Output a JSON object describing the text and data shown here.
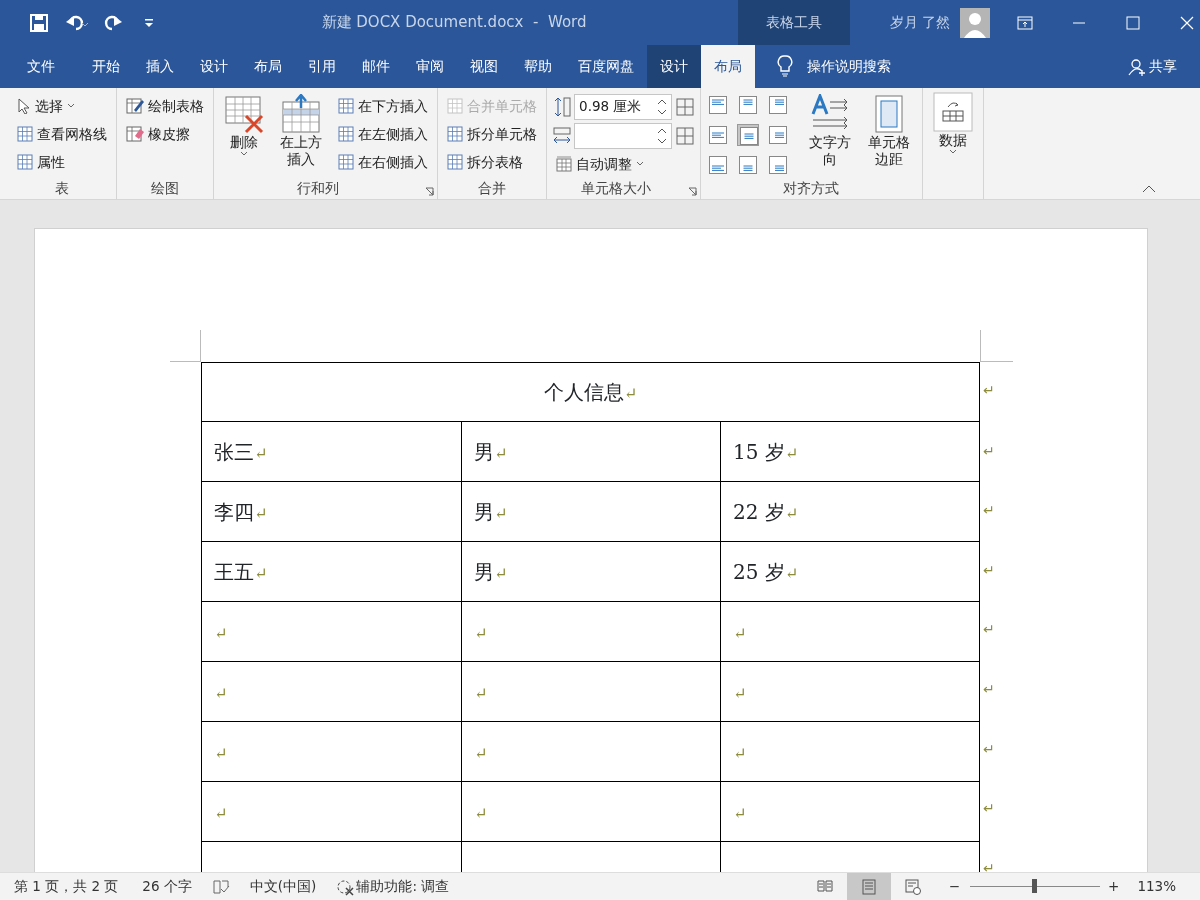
{
  "window": {
    "title": "新建 DOCX Document.docx  -  Word",
    "context_label": "表格工具",
    "user": "岁月 了然"
  },
  "tabs": [
    {
      "label": "文件",
      "selected": false,
      "contextual": false
    },
    {
      "label": "开始",
      "selected": false,
      "contextual": false
    },
    {
      "label": "插入",
      "selected": false,
      "contextual": false
    },
    {
      "label": "设计",
      "selected": false,
      "contextual": false
    },
    {
      "label": "布局",
      "selected": false,
      "contextual": false
    },
    {
      "label": "引用",
      "selected": false,
      "contextual": false
    },
    {
      "label": "邮件",
      "selected": false,
      "contextual": false
    },
    {
      "label": "审阅",
      "selected": false,
      "contextual": false
    },
    {
      "label": "视图",
      "selected": false,
      "contextual": false
    },
    {
      "label": "帮助",
      "selected": false,
      "contextual": false
    },
    {
      "label": "百度网盘",
      "selected": false,
      "contextual": false
    },
    {
      "label": "设计",
      "selected": false,
      "contextual": true
    },
    {
      "label": "布局",
      "selected": true,
      "contextual": true
    }
  ],
  "tell_me": "操作说明搜索",
  "share": "共享",
  "ribbon": {
    "groups": [
      {
        "label": "表",
        "items": [
          {
            "kind": "small",
            "label": "选择",
            "dropdown": true
          },
          {
            "kind": "small",
            "label": "查看网格线"
          },
          {
            "kind": "small",
            "label": "属性"
          }
        ]
      },
      {
        "label": "绘图",
        "items": [
          {
            "kind": "small",
            "label": "绘制表格"
          },
          {
            "kind": "small",
            "label": "橡皮擦"
          }
        ]
      },
      {
        "label": "行和列",
        "launcher": true,
        "items": [
          {
            "kind": "large",
            "label": "删除",
            "dropdown": true
          },
          {
            "kind": "large",
            "label": "在上方插入"
          },
          {
            "kind": "small",
            "label": "在下方插入"
          },
          {
            "kind": "small",
            "label": "在左侧插入"
          },
          {
            "kind": "small",
            "label": "在右侧插入"
          }
        ]
      },
      {
        "label": "合并",
        "items": [
          {
            "kind": "small",
            "label": "合并单元格",
            "disabled": true
          },
          {
            "kind": "small",
            "label": "拆分单元格",
            "disabled": false
          },
          {
            "kind": "small",
            "label": "拆分表格",
            "disabled": false
          }
        ]
      },
      {
        "label": "单元格大小",
        "launcher": true,
        "items": [
          {
            "kind": "field",
            "value": "0.98 厘米"
          },
          {
            "kind": "field"
          },
          {
            "kind": "small",
            "label": "自动调整",
            "dropdown": true
          }
        ]
      },
      {
        "label": "对齐方式",
        "items": [
          {
            "kind": "align_grid",
            "cells": [
              {
                "selected": false
              },
              {
                "selected": false
              },
              {
                "selected": false
              },
              {
                "selected": false
              },
              {
                "selected": true
              },
              {
                "selected": false
              },
              {
                "selected": false
              },
              {
                "selected": false
              },
              {
                "selected": false
              }
            ]
          },
          {
            "kind": "large",
            "label": "文字方向"
          },
          {
            "kind": "large",
            "label": "单元格边距"
          }
        ]
      },
      {
        "items": [
          {
            "kind": "large",
            "label": "数据",
            "dropdown": true
          }
        ]
      }
    ]
  },
  "table": {
    "title": {
      "text": "个人信息",
      "mark": "↵"
    },
    "title_end_mark": "↵",
    "rows": [
      {
        "cells": [
          {
            "text": "张三",
            "mark": "↵"
          },
          {
            "text": "男",
            "mark": "↵"
          },
          {
            "text": "15 岁",
            "mark": "↵"
          }
        ],
        "end_mark": "↵"
      },
      {
        "cells": [
          {
            "text": "李四",
            "mark": "↵"
          },
          {
            "text": "男",
            "mark": "↵"
          },
          {
            "text": "22 岁",
            "mark": "↵"
          }
        ],
        "end_mark": "↵"
      },
      {
        "cells": [
          {
            "text": "王五",
            "mark": "↵"
          },
          {
            "text": "男",
            "mark": "↵"
          },
          {
            "text": "25 岁",
            "mark": "↵"
          }
        ],
        "end_mark": "↵"
      },
      {
        "cells": [
          {
            "mark": "↵"
          },
          {
            "mark": "↵"
          },
          {
            "mark": "↵"
          }
        ],
        "end_mark": "↵"
      },
      {
        "cells": [
          {
            "mark": "↵"
          },
          {
            "mark": "↵"
          },
          {
            "mark": "↵"
          }
        ],
        "end_mark": "↵"
      },
      {
        "cells": [
          {
            "mark": "↵"
          },
          {
            "mark": "↵"
          },
          {
            "mark": "↵"
          }
        ],
        "end_mark": "↵"
      },
      {
        "cells": [
          {
            "mark": "↵"
          },
          {
            "mark": "↵"
          },
          {
            "mark": "↵"
          }
        ],
        "end_mark": "↵"
      },
      {
        "cells": [
          {},
          {},
          {}
        ],
        "end_mark": "↵"
      }
    ]
  },
  "status_bar": {
    "page": "第 1 页，共 2 页",
    "words": "26 个字",
    "language": "中文(中国)",
    "accessibility": "辅助功能: 调查",
    "views": [
      {
        "kind": "read",
        "selected": false
      },
      {
        "kind": "print",
        "selected": true
      },
      {
        "kind": "web",
        "selected": false
      }
    ],
    "zoom_minus": "−",
    "zoom_plus": "+",
    "zoom": {
      "level": 0.49
    },
    "zoom_reading": "113%"
  }
}
